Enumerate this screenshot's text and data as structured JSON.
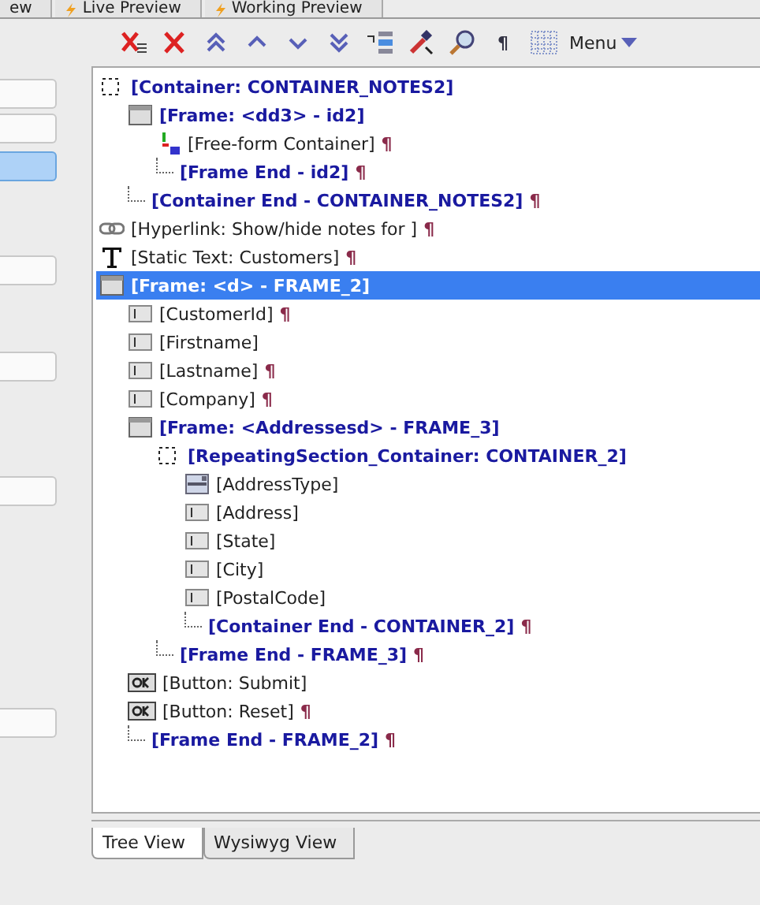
{
  "top_tabs": [
    {
      "label": "ew",
      "selected": false,
      "icon": false
    },
    {
      "label": "Live Preview",
      "selected": false,
      "icon": true
    },
    {
      "label": "Working Preview",
      "selected": false,
      "icon": true
    }
  ],
  "left_panel": {
    "items": [
      {
        "selected": false
      },
      {
        "selected": false
      },
      {
        "selected": true
      },
      {
        "selected": false
      },
      {
        "selected": false
      },
      {
        "selected": false
      },
      {
        "selected": false
      }
    ]
  },
  "toolbar": [
    {
      "kind": "delete-all"
    },
    {
      "kind": "delete"
    },
    {
      "kind": "top"
    },
    {
      "kind": "up"
    },
    {
      "kind": "down"
    },
    {
      "kind": "bottom"
    },
    {
      "kind": "list"
    },
    {
      "kind": "picker"
    },
    {
      "kind": "zoom"
    },
    {
      "kind": "text",
      "label": "¶"
    },
    {
      "kind": "grid"
    },
    {
      "kind": "menu",
      "label": "Menu"
    }
  ],
  "tree": [
    {
      "kind": "container",
      "label": "[Container: CONTAINER_NOTES2]",
      "pilcrow": false,
      "selected": false,
      "children": [
        {
          "kind": "frame",
          "label": "[Frame: <dd3> - id2]",
          "pilcrow": false,
          "selected": false,
          "children": [
            {
              "kind": "html",
              "label": "[Free-form Container]",
              "pilcrow": true,
              "selected": false
            },
            {
              "kind": "end",
              "label": "[Frame End - id2]",
              "pilcrow": true,
              "selected": false
            }
          ]
        },
        {
          "kind": "end",
          "label": "[Container End - CONTAINER_NOTES2]",
          "pilcrow": true,
          "selected": false
        }
      ]
    },
    {
      "kind": "hyperlink",
      "label": "[Hyperlink: Show/hide notes for ]",
      "pilcrow": true,
      "selected": false
    },
    {
      "kind": "static",
      "label": "[Static Text: Customers]",
      "pilcrow": true,
      "selected": false
    },
    {
      "kind": "frame",
      "label": "[Frame: <d> - FRAME_2]",
      "pilcrow": false,
      "selected": true,
      "children": [
        {
          "kind": "field",
          "label": "[CustomerId]",
          "pilcrow": true,
          "selected": false
        },
        {
          "kind": "field",
          "label": "[Firstname]",
          "pilcrow": false,
          "selected": false
        },
        {
          "kind": "field",
          "label": "[Lastname]",
          "pilcrow": true,
          "selected": false
        },
        {
          "kind": "field",
          "label": "[Company]",
          "pilcrow": true,
          "selected": false
        },
        {
          "kind": "frame",
          "label": "[Frame: <Addressesd> - FRAME_3]",
          "pilcrow": false,
          "selected": false,
          "children": [
            {
              "kind": "container",
              "label": "[RepeatingSection_Container: CONTAINER_2]",
              "pilcrow": false,
              "selected": false,
              "children": [
                {
                  "kind": "combo",
                  "label": "[AddressType]",
                  "pilcrow": false,
                  "selected": false
                },
                {
                  "kind": "field",
                  "label": "[Address]",
                  "pilcrow": false,
                  "selected": false
                },
                {
                  "kind": "field",
                  "label": "[State]",
                  "pilcrow": false,
                  "selected": false
                },
                {
                  "kind": "field",
                  "label": "[City]",
                  "pilcrow": false,
                  "selected": false
                },
                {
                  "kind": "field",
                  "label": "[PostalCode]",
                  "pilcrow": false,
                  "selected": false
                },
                {
                  "kind": "end",
                  "label": "[Container End - CONTAINER_2]",
                  "pilcrow": true,
                  "selected": false
                }
              ]
            },
            {
              "kind": "end",
              "label": "[Frame End - FRAME_3]",
              "pilcrow": true,
              "selected": false
            }
          ]
        },
        {
          "kind": "button",
          "label": "[Button: Submit]",
          "pilcrow": false,
          "selected": false
        },
        {
          "kind": "button",
          "label": "[Button: Reset]",
          "pilcrow": true,
          "selected": false
        },
        {
          "kind": "end",
          "label": "[Frame End - FRAME_2]",
          "pilcrow": true,
          "selected": false
        }
      ]
    }
  ],
  "pilcrow": "¶",
  "bottom_tabs": [
    {
      "label": "Tree View",
      "selected": true
    },
    {
      "label": "Wysiwyg View",
      "selected": false
    }
  ]
}
